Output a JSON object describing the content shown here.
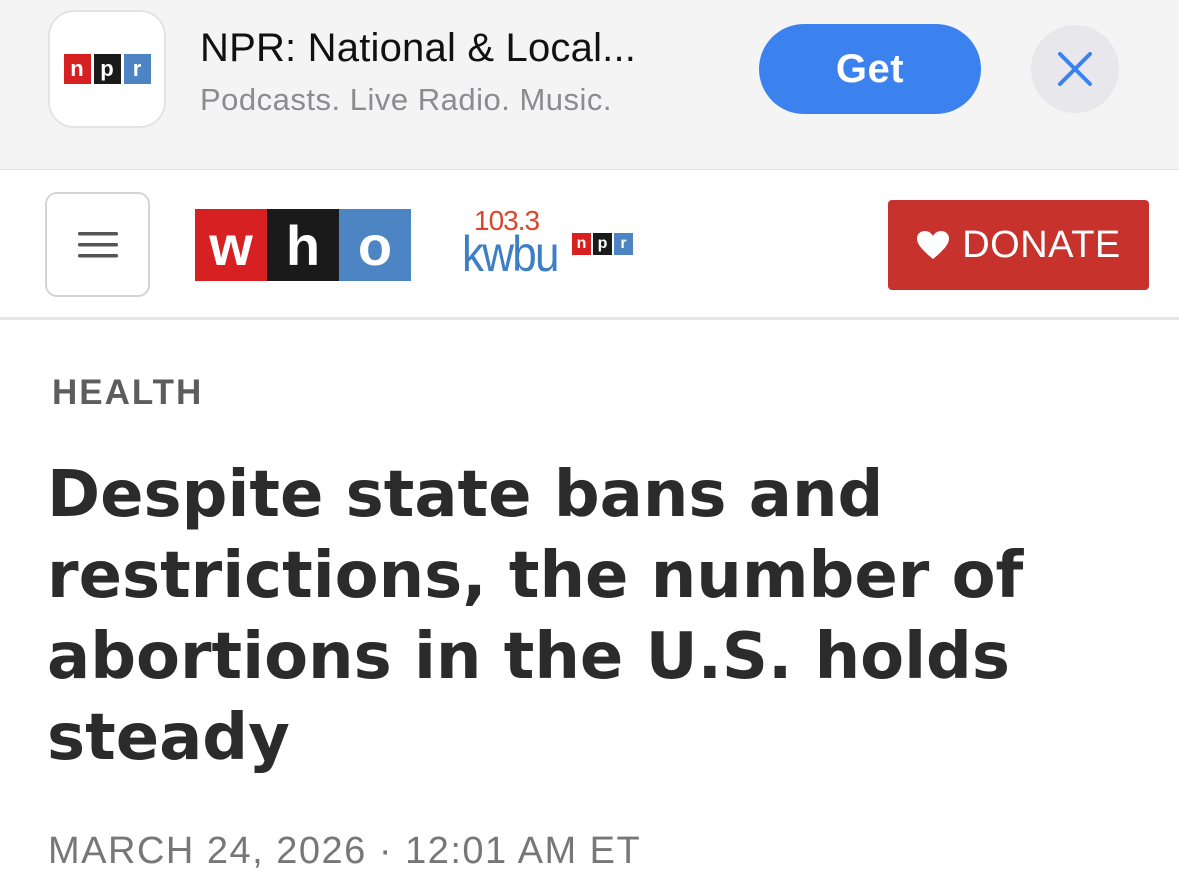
{
  "app_banner": {
    "icon_letters": [
      "n",
      "p",
      "r"
    ],
    "title": "NPR: National & Local...",
    "subtitle": "Podcasts. Live Radio. Music.",
    "get_label": "Get",
    "close_icon": "close-icon"
  },
  "site_header": {
    "menu_icon": "hamburger-icon",
    "who_letters": [
      "w",
      "h",
      "o"
    ],
    "kwbu_frequency": "103.3",
    "kwbu_callsign": "kwbu",
    "kwbu_npr_letters": [
      "n",
      "p",
      "r"
    ],
    "donate_label": "DONATE",
    "donate_icon": "heart-icon"
  },
  "article": {
    "section": "HEALTH",
    "headline": "Despite state bans and restrictions, the number of abortions in the U.S. holds steady",
    "dateline": "MARCH 24, 2026 · 12:01 AM ET"
  },
  "colors": {
    "npr_red": "#d62021",
    "npr_black": "#1a1a1a",
    "npr_blue": "#4c84c4",
    "get_button": "#3b82ee",
    "donate_button": "#c7322d",
    "kwbu_orange": "#d9462c",
    "kwbu_blue": "#3c7fc4"
  }
}
